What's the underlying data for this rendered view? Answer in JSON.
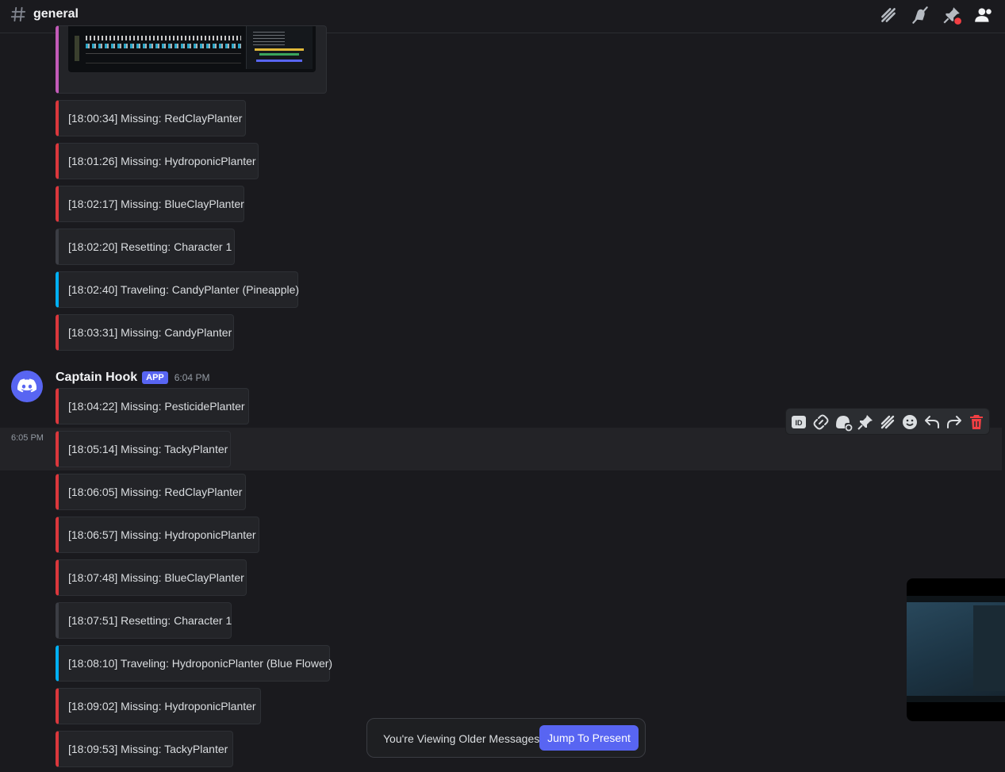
{
  "channel": {
    "name": "general"
  },
  "header_tools": [
    "threads-icon",
    "mute-icon",
    "pinned-icon",
    "members-icon"
  ],
  "author": {
    "name": "Captain Hook",
    "tag": "APP",
    "time": "6:04 PM"
  },
  "hover_timestamp": "6:05 PM",
  "embeds_before": [
    {
      "text": "[18:00:34] Missing: RedClayPlanter",
      "kind": "missing"
    },
    {
      "text": "[18:01:26] Missing: HydroponicPlanter",
      "kind": "missing"
    },
    {
      "text": "[18:02:17] Missing: BlueClayPlanter",
      "kind": "missing"
    },
    {
      "text": "[18:02:20] Resetting: Character 1",
      "kind": "reset"
    },
    {
      "text": "[18:02:40] Traveling: CandyPlanter (Pineapple)",
      "kind": "travel"
    },
    {
      "text": "[18:03:31] Missing: CandyPlanter",
      "kind": "missing"
    }
  ],
  "embeds_after": [
    {
      "text": "[18:04:22] Missing: PesticidePlanter",
      "kind": "missing"
    },
    {
      "text": "[18:05:14] Missing: TackyPlanter",
      "kind": "missing"
    },
    {
      "text": "[18:06:05] Missing: RedClayPlanter",
      "kind": "missing"
    },
    {
      "text": "[18:06:57] Missing: HydroponicPlanter",
      "kind": "missing"
    },
    {
      "text": "[18:07:48] Missing: BlueClayPlanter",
      "kind": "missing"
    },
    {
      "text": "[18:07:51] Resetting: Character 1",
      "kind": "reset"
    },
    {
      "text": "[18:08:10] Traveling: HydroponicPlanter (Blue Flower)",
      "kind": "travel"
    },
    {
      "text": "[18:09:02] Missing: HydroponicPlanter",
      "kind": "missing"
    },
    {
      "text": "[18:09:53] Missing: TackyPlanter",
      "kind": "missing"
    }
  ],
  "action_bar": [
    "copy-id-icon",
    "copy-link-icon",
    "mark-unread-icon",
    "pin-icon",
    "create-thread-icon",
    "add-reaction-icon",
    "reply-icon",
    "forward-icon",
    "delete-icon"
  ],
  "toast": {
    "message": "You're Viewing Older Messages",
    "jump_label": "Jump To Present"
  },
  "colors": {
    "missing": "#da373c",
    "reset": "#3b3d44",
    "travel": "#00b0f4",
    "brand": "#5865f2",
    "embed_image_border": "#c35bb8"
  }
}
